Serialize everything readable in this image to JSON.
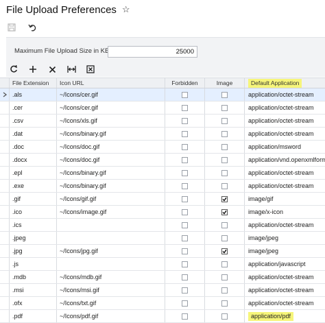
{
  "header": {
    "title": "File Upload Preferences",
    "favorite_icon": "star-outline-icon"
  },
  "toolbar": {
    "save_icon": "save-icon",
    "undo_icon": "undo-icon"
  },
  "form": {
    "max_size_label": "Maximum File Upload Size in KB:",
    "max_size_value": "25000"
  },
  "grid_toolbar": {
    "icons": [
      "refresh-icon",
      "add-icon",
      "delete-icon",
      "fit-columns-icon",
      "export-icon"
    ]
  },
  "grid": {
    "columns": [
      "File Extension",
      "Icon URL",
      "Forbidden",
      "Image",
      "Default Application"
    ],
    "highlight_color": "#f6f57a",
    "rows": [
      {
        "ext": ".als",
        "url": "~/Icons/cer.gif",
        "forbidden": false,
        "image": false,
        "app": "application/octet-stream",
        "selected": true
      },
      {
        "ext": ".cer",
        "url": "~/Icons/cer.gif",
        "forbidden": false,
        "image": false,
        "app": "application/octet-stream"
      },
      {
        "ext": ".csv",
        "url": "~/Icons/xls.gif",
        "forbidden": false,
        "image": false,
        "app": "application/octet-stream"
      },
      {
        "ext": ".dat",
        "url": "~/Icons/binary.gif",
        "forbidden": false,
        "image": false,
        "app": "application/octet-stream"
      },
      {
        "ext": ".doc",
        "url": "~/Icons/doc.gif",
        "forbidden": false,
        "image": false,
        "app": "application/msword"
      },
      {
        "ext": ".docx",
        "url": "~/Icons/doc.gif",
        "forbidden": false,
        "image": false,
        "app": "application/vnd.openxmlformat"
      },
      {
        "ext": ".epl",
        "url": "~/Icons/binary.gif",
        "forbidden": false,
        "image": false,
        "app": "application/octet-stream"
      },
      {
        "ext": ".exe",
        "url": "~/Icons/binary.gif",
        "forbidden": false,
        "image": false,
        "app": "application/octet-stream"
      },
      {
        "ext": ".gif",
        "url": "~/Icons/gif.gif",
        "forbidden": false,
        "image": true,
        "app": "image/gif"
      },
      {
        "ext": ".ico",
        "url": "~/Icons/image.gif",
        "forbidden": false,
        "image": true,
        "app": "image/x-icon"
      },
      {
        "ext": ".ics",
        "url": "",
        "forbidden": false,
        "image": false,
        "app": "application/octet-stream"
      },
      {
        "ext": ".jpeg",
        "url": "",
        "forbidden": false,
        "image": false,
        "app": "image/jpeg"
      },
      {
        "ext": ".jpg",
        "url": "~/Icons/jpg.gif",
        "forbidden": false,
        "image": true,
        "app": "image/jpeg"
      },
      {
        "ext": ".js",
        "url": "",
        "forbidden": false,
        "image": false,
        "app": "application/javascript"
      },
      {
        "ext": ".mdb",
        "url": "~/Icons/mdb.gif",
        "forbidden": false,
        "image": false,
        "app": "application/octet-stream"
      },
      {
        "ext": ".msi",
        "url": "~/Icons/msi.gif",
        "forbidden": false,
        "image": false,
        "app": "application/octet-stream"
      },
      {
        "ext": ".ofx",
        "url": "~/Icons/txt.gif",
        "forbidden": false,
        "image": false,
        "app": "application/octet-stream"
      },
      {
        "ext": ".pdf",
        "url": "~/Icons/pdf.gif",
        "forbidden": false,
        "image": false,
        "app": "application/pdf",
        "app_highlighted": true
      }
    ]
  }
}
